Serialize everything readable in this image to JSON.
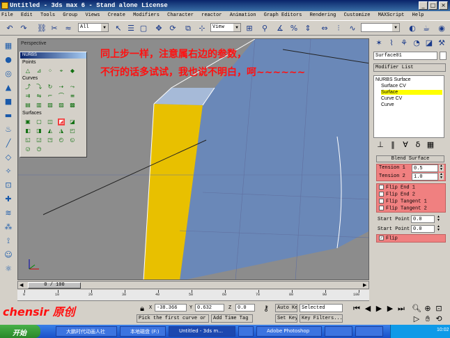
{
  "window": {
    "title": "Untitled - 3ds max 6 - Stand alone License"
  },
  "menu": [
    "File",
    "Edit",
    "Tools",
    "Group",
    "Views",
    "Create",
    "Modifiers",
    "Character",
    "reactor",
    "Animation",
    "Graph Editors",
    "Rendering",
    "Customize",
    "MAXScript",
    "Help"
  ],
  "toolbar": {
    "selection_filter": "All",
    "view_dropdown": "View"
  },
  "viewport": {
    "label": "Perspective"
  },
  "nurbs_palette": {
    "title": "NURBS",
    "sections": [
      "Points",
      "Curves",
      "Surfaces"
    ]
  },
  "annotation": {
    "line1": "同上步一样，注意属右边的参数，",
    "line2": "不行的话多试试，我也说不明白，呵~~~~~~"
  },
  "command_panel": {
    "object_name": "Surface01",
    "modifier_list": "Modifier List",
    "stack": [
      "NURBS Surface",
      "Surface CV",
      "Surface",
      "Curve CV",
      "Curve"
    ],
    "selected_stack_index": 2,
    "rollout_title": "Blend Surface",
    "tension1": {
      "label": "Tension 1",
      "value": "0.5"
    },
    "tension2": {
      "label": "Tension 2",
      "value": "1.0"
    },
    "flips": [
      "Flip End 1",
      "Flip End 2",
      "Flip Tangent 1",
      "Flip Tangent 2"
    ],
    "start_point1": {
      "label": "Start Point 1:",
      "value": "0.0"
    },
    "start_point2": {
      "label": "Start Point 2:",
      "value": "0.0"
    },
    "flip": {
      "label": "Flip",
      "checked": true
    }
  },
  "timeline": {
    "current": "0 / 100",
    "ticks": [
      "0",
      "10",
      "20",
      "30",
      "40",
      "50",
      "60",
      "70",
      "80",
      "90",
      "100"
    ]
  },
  "status": {
    "watermark": "chensir 原创",
    "x_label": "X",
    "x_value": "-38.366",
    "y_label": "Y",
    "y_value": "0.632",
    "z_label": "Z",
    "z_value": "0.0",
    "prompt": "Pick the first curve or",
    "add_time_tag": "Add Time Tag",
    "auto_key": "Auto Key",
    "set_key": "Set Key",
    "selected": "Selected",
    "key_filters": "Key Filters..."
  },
  "taskbar": {
    "start": "开始",
    "tasks": [
      "大鹏时代动画人社",
      "本地磁盘 (F:)",
      "Untitled - 3ds m...",
      "",
      "Adobe Photoshop",
      "",
      ""
    ],
    "clock": "10:02"
  },
  "colors": {
    "title_bg": "#0a246a",
    "highlight": "#ffff00",
    "rollout_red": "#f08080",
    "annotation": "#ff1010",
    "yellow_face": "#e8c000",
    "blue_surface": "#6a88b8"
  }
}
